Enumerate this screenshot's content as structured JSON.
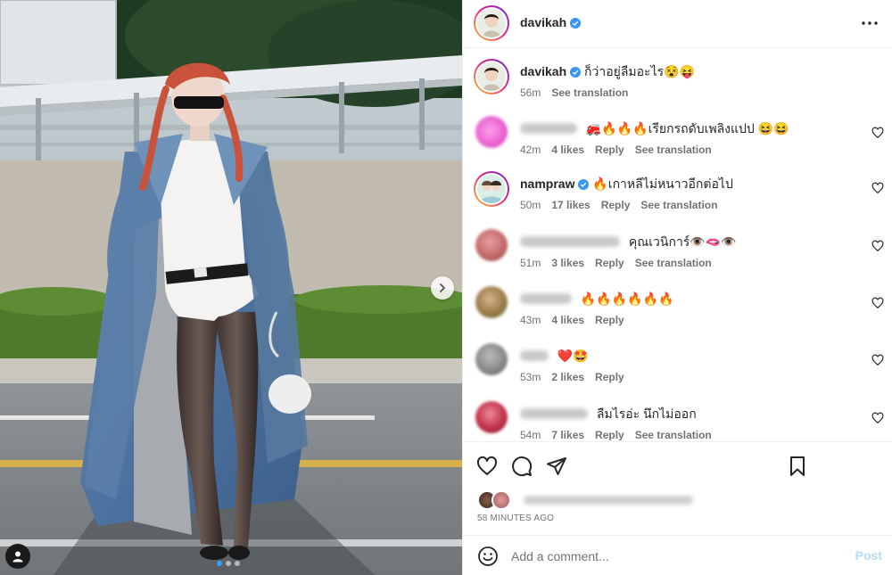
{
  "post": {
    "username": "davikah",
    "verified": true
  },
  "caption": {
    "username": "davikah",
    "text": "ก็ว่าอยู่ลืมอะไร😵😝",
    "time": "56m",
    "see_translation": "See translation"
  },
  "comments": [
    {
      "username_visible": false,
      "text": "🚒🔥🔥🔥เรียกรถดับเพลิงแปป 😆😆",
      "time": "42m",
      "likes": "4 likes",
      "reply": "Reply",
      "see_translation": "See translation",
      "avatar_color": "#e85fd0"
    },
    {
      "username": "nampraw",
      "verified": true,
      "text": "🔥เกาหลีไม่หนาวอีกต่อไป",
      "time": "50m",
      "likes": "17 likes",
      "reply": "Reply",
      "see_translation": "See translation",
      "avatar_color": "#d8e8e0"
    },
    {
      "username_visible": false,
      "text": "คุณเวนิการ์👁️🫦👁️",
      "time": "51m",
      "likes": "3 likes",
      "reply": "Reply",
      "see_translation": "See translation",
      "avatar_color": "#c46a6a"
    },
    {
      "username_visible": false,
      "text": "🔥🔥🔥🔥🔥🔥",
      "time": "43m",
      "likes": "4 likes",
      "reply": "Reply",
      "avatar_color": "#9a7a4a"
    },
    {
      "username_visible": false,
      "text": "❤️🤩",
      "time": "53m",
      "likes": "2 likes",
      "reply": "Reply",
      "avatar_color": "#8a8a8a"
    },
    {
      "username_visible": false,
      "text": "ลืมไรอ่ะ นึกไม่ออก",
      "time": "54m",
      "likes": "7 likes",
      "reply": "Reply",
      "see_translation": "See translation",
      "avatar_color": "#c0304a"
    }
  ],
  "footer": {
    "time_ago": "58 MINUTES AGO"
  },
  "add_comment": {
    "placeholder": "Add a comment...",
    "post_label": "Post"
  },
  "icons": {
    "more": "more-horizontal-icon",
    "next": "chevron-right-icon",
    "tag": "user-tag-icon",
    "like": "heart-icon",
    "comment": "comment-bubble-icon",
    "share": "paper-plane-icon",
    "save": "bookmark-icon",
    "emoji": "emoji-smile-icon"
  },
  "colors": {
    "verified": "#3897f0",
    "post_disabled": "#b3dbff",
    "secondary_text": "#737373",
    "active_dot": "#3aa0f0"
  }
}
